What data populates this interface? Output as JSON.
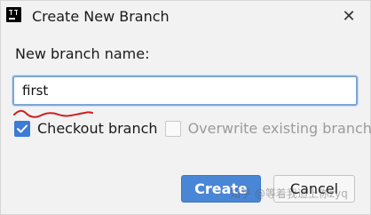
{
  "window": {
    "title": "Create New Branch",
    "close_glyph": "✕"
  },
  "form": {
    "branch_name_label": "New branch name:",
    "branch_name_value": "first"
  },
  "options": {
    "checkout": {
      "label": "Checkout branch",
      "checked": true
    },
    "overwrite": {
      "label": "Overwrite existing branch",
      "checked": false,
      "disabled": true
    }
  },
  "buttons": {
    "create_label": "Create",
    "cancel_label": "Cancel"
  },
  "watermark": {
    "text": "知乎 @等着我追上你zyq"
  },
  "icons": {
    "app": "intellij-icon",
    "close": "close-icon",
    "check": "check-icon"
  },
  "colors": {
    "accent": "#3c7bd6",
    "primary_button": "#4a86d6",
    "annotation": "#cc1f1f"
  }
}
